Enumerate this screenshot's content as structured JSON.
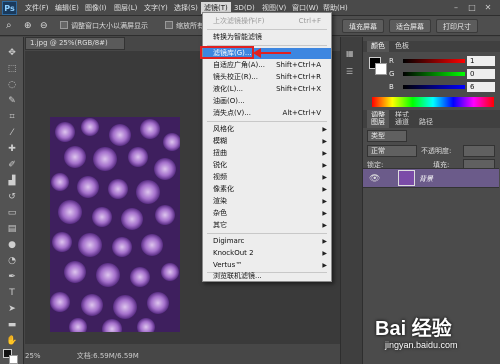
{
  "app": {
    "logo": "Ps"
  },
  "menubar": {
    "items": [
      "文件(F)",
      "编辑(E)",
      "图像(I)",
      "图层(L)",
      "文字(Y)",
      "选择(S)",
      "滤镜(T)",
      "3D(D)",
      "视图(V)",
      "窗口(W)",
      "帮助(H)"
    ],
    "active_index": 6,
    "window_controls": [
      "–",
      "□",
      "✕"
    ]
  },
  "options_bar": {
    "checkbox1_label": "调整窗口大小以满屏显示",
    "checkbox2_label": "缩放所有",
    "fill_screen": "填充屏幕",
    "fit_screen": "适合屏幕",
    "print_size": "打印尺寸"
  },
  "document": {
    "tab_title": "1.jpg @ 25%(RGB/8#)",
    "zoom": "25%",
    "doc_size": "文档:6.59M/6.59M"
  },
  "filter_menu": {
    "items": [
      {
        "label": "上次滤镜操作(F)",
        "shortcut": "Ctrl+F",
        "disabled": true
      },
      {
        "label": "转换为智能滤镜"
      },
      {
        "label": "滤镜库(G)...",
        "highlighted": true
      },
      {
        "label": "自适应广角(A)...",
        "shortcut": "Shift+Ctrl+A"
      },
      {
        "label": "镜头校正(R)...",
        "shortcut": "Shift+Ctrl+R"
      },
      {
        "label": "液化(L)...",
        "shortcut": "Shift+Ctrl+X"
      },
      {
        "label": "油画(O)..."
      },
      {
        "label": "消失点(V)...",
        "shortcut": "Alt+Ctrl+V"
      },
      {
        "label": "风格化",
        "submenu": true
      },
      {
        "label": "模糊",
        "submenu": true
      },
      {
        "label": "扭曲",
        "submenu": true
      },
      {
        "label": "锐化",
        "submenu": true
      },
      {
        "label": "视频",
        "submenu": true
      },
      {
        "label": "像素化",
        "submenu": true
      },
      {
        "label": "渲染",
        "submenu": true
      },
      {
        "label": "杂色",
        "submenu": true
      },
      {
        "label": "其它",
        "submenu": true
      },
      {
        "label": "Digimarc",
        "submenu": true
      },
      {
        "label": "KnockOut 2",
        "submenu": true
      },
      {
        "label": "Vertus™",
        "submenu": true
      },
      {
        "label": "浏览联机滤镜..."
      }
    ]
  },
  "color_panel": {
    "tabs": [
      "颜色",
      "色板"
    ],
    "r_label": "R",
    "r_value": "1",
    "g_label": "G",
    "g_value": "0",
    "b_label": "B",
    "b_value": "6"
  },
  "adjust_panel": {
    "tabs": [
      "调整",
      "样式"
    ]
  },
  "layers_panel": {
    "tabs": [
      "图层",
      "通道",
      "路径"
    ],
    "kind_filter": "类型",
    "blend_mode": "正常",
    "opacity_label": "不透明度:",
    "lock_label": "锁定:",
    "fill_label": "填充:",
    "layer_name": "背景"
  },
  "watermark": {
    "brand": "Bai 经验",
    "url": "jingyan.baidu.com"
  },
  "colors": {
    "accent": "#3d86e0",
    "highlight_box": "#e02020"
  }
}
